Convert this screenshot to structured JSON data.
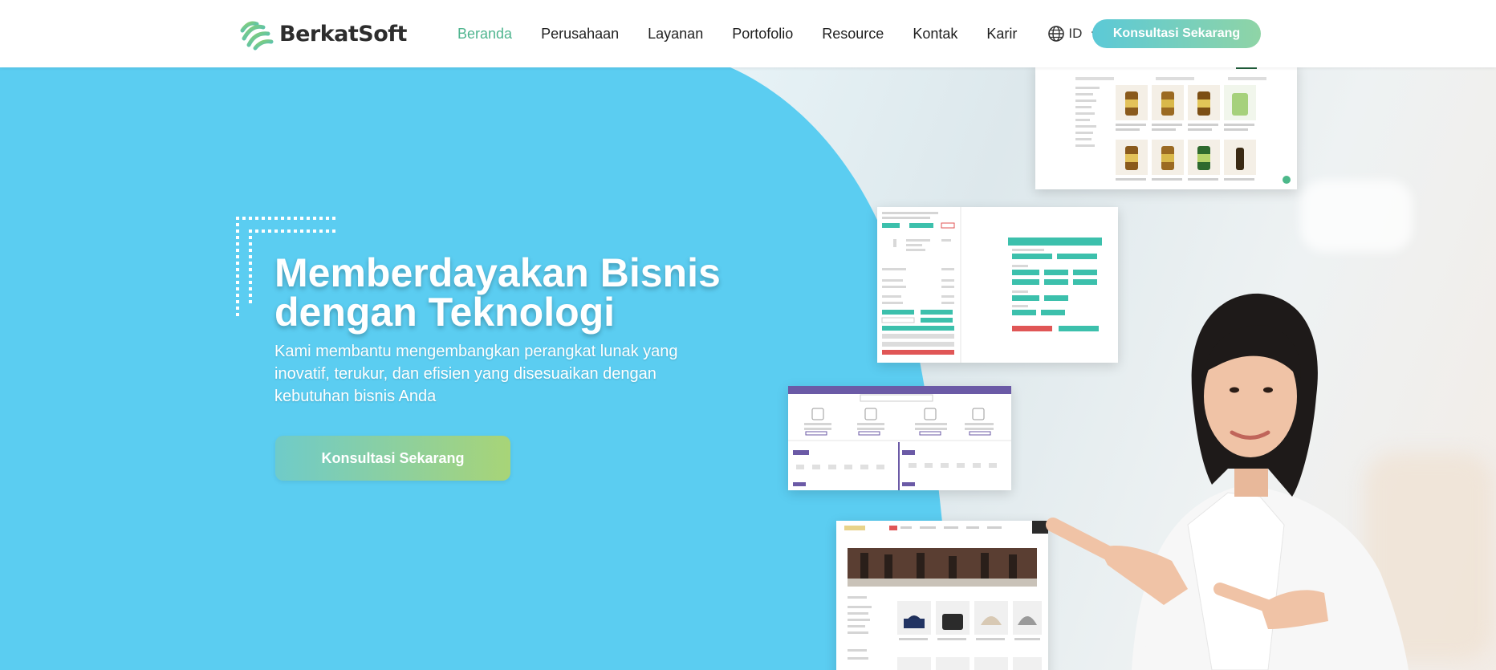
{
  "brand": {
    "name": "BerkatSoft",
    "colors": {
      "accent": "#4fb58f",
      "hero_blue": "#5bcdf1",
      "cta_start": "#5bc9d7",
      "cta_end": "#8fd4a6"
    }
  },
  "nav": {
    "items": [
      {
        "label": "Beranda",
        "active": true
      },
      {
        "label": "Perusahaan",
        "active": false
      },
      {
        "label": "Layanan",
        "active": false
      },
      {
        "label": "Portofolio",
        "active": false
      },
      {
        "label": "Resource",
        "active": false
      },
      {
        "label": "Kontak",
        "active": false
      },
      {
        "label": "Karir",
        "active": false
      }
    ],
    "language": {
      "label": "ID",
      "icon": "globe-icon"
    },
    "cta_label": "Konsultasi Sekarang"
  },
  "hero": {
    "title": "Memberdayakan Bisnis dengan Teknologi",
    "subtitle": "Kami membantu mengembangkan perangkat lunak yang inovatif, terukur, dan efisien yang disesuaikan dengan kebutuhan bisnis Anda",
    "cta_label": "Konsultasi Sekarang"
  }
}
